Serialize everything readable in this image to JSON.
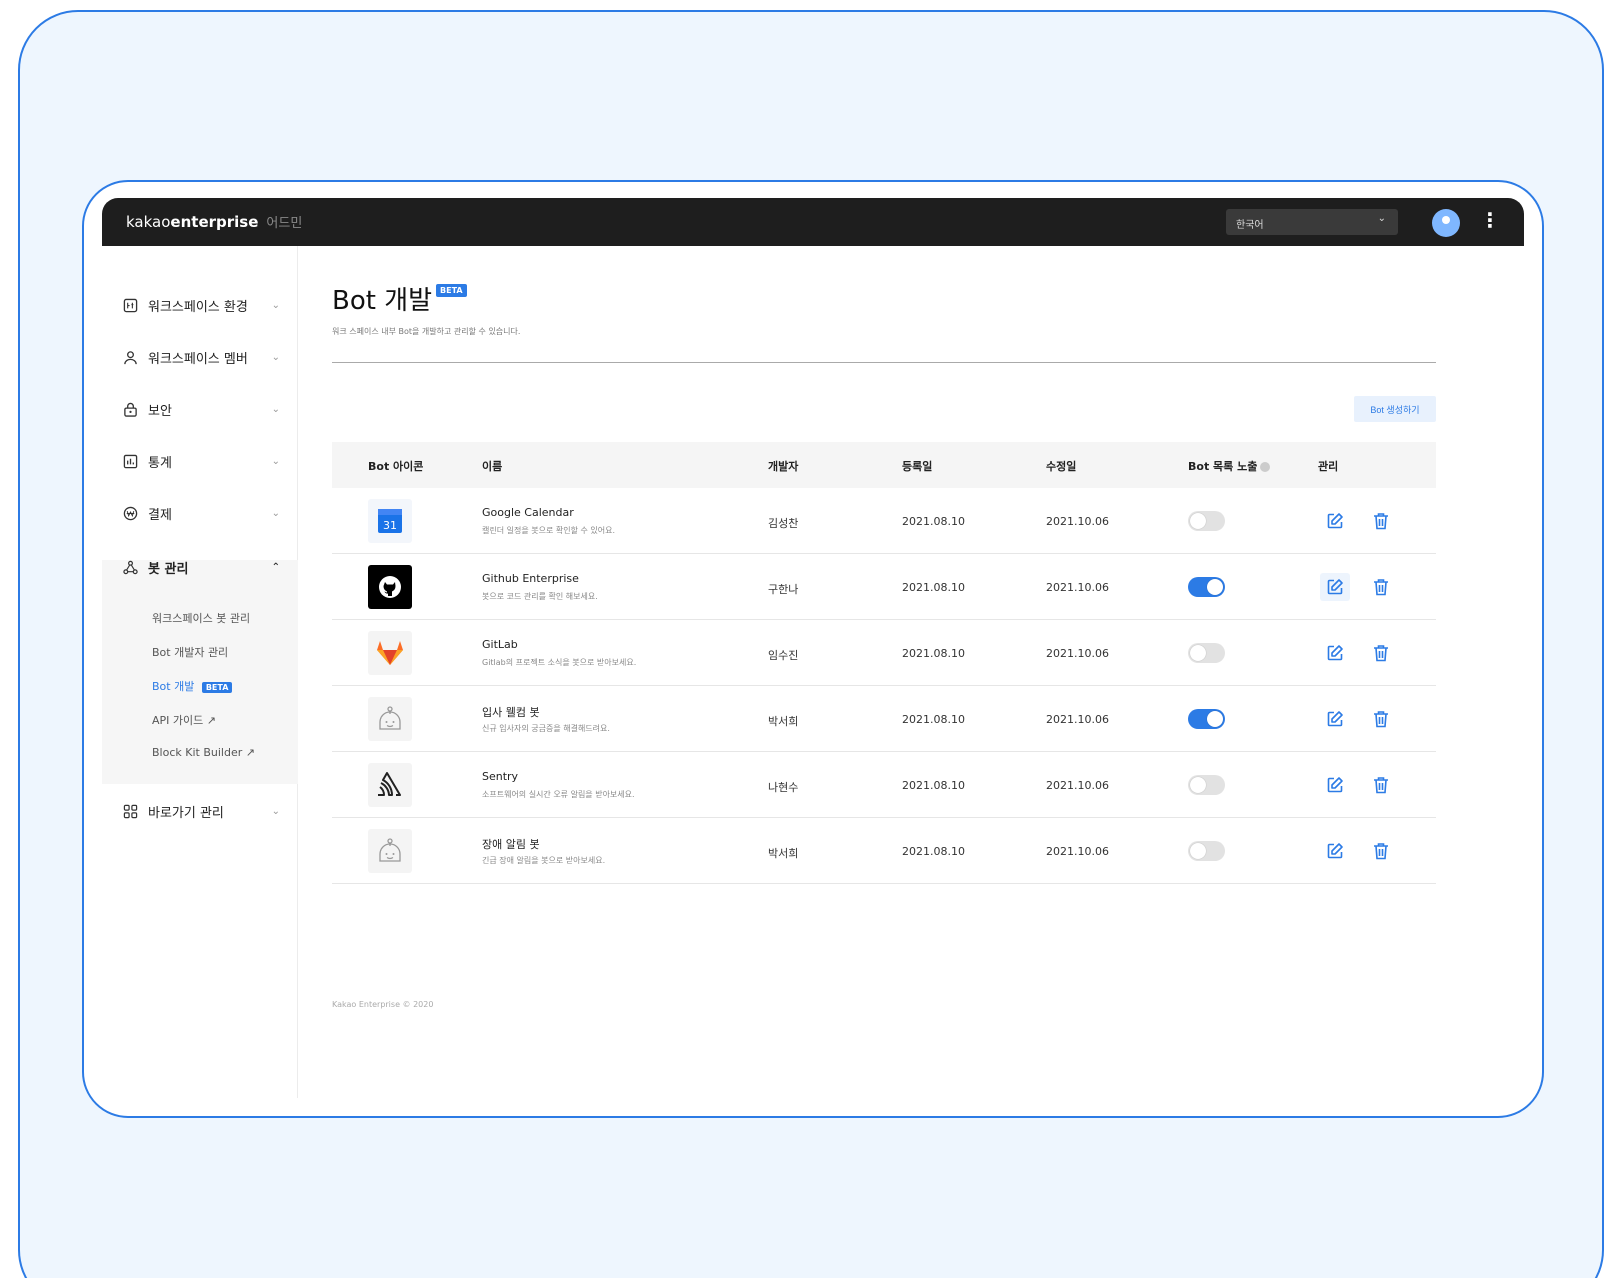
{
  "topbar": {
    "brand_part1": "kakao",
    "brand_part2": "enterprise",
    "brand_suffix": "어드민",
    "language": "한국어"
  },
  "sidebar": {
    "items": [
      {
        "label": "워크스페이스 환경",
        "icon": "workspace-settings-icon",
        "chevron": "⌄"
      },
      {
        "label": "워크스페이스 멤버",
        "icon": "person-icon",
        "chevron": "⌄"
      },
      {
        "label": "보안",
        "icon": "lock-icon",
        "chevron": "⌄"
      },
      {
        "label": "통계",
        "icon": "chart-icon",
        "chevron": "⌄"
      },
      {
        "label": "결제",
        "icon": "won-icon",
        "chevron": "⌄"
      },
      {
        "label": "봇 관리",
        "icon": "bot-network-icon",
        "chevron": "⌃"
      },
      {
        "label": "바로가기 관리",
        "icon": "grid-icon",
        "chevron": "⌄"
      }
    ],
    "sub_items": [
      {
        "label": "워크스페이스 봇 관리"
      },
      {
        "label": "Bot 개발자 관리"
      },
      {
        "label": "Bot 개발",
        "badge": "BETA"
      },
      {
        "label": "API 가이드 ↗"
      },
      {
        "label": "Block Kit Builder ↗"
      }
    ]
  },
  "main": {
    "title": "Bot 개발",
    "title_badge": "BETA",
    "description": "워크 스페이스 내부 Bot을 개발하고 관리할 수 있습니다.",
    "create_button": "Bot 생성하기",
    "columns": [
      "Bot 아이콘",
      "이름",
      "개발자",
      "등록일",
      "수정일",
      "Bot 목록 노출",
      "관리"
    ],
    "rows": [
      {
        "name": "Google Calendar",
        "desc": "캘린더 일정을 봇으로 확인할 수 있어요.",
        "developer": "김성찬",
        "registered": "2021.08.10",
        "modified": "2021.10.06",
        "exposed": false,
        "icon": "google-calendar-icon",
        "icon_text": "31"
      },
      {
        "name": "Github Enterprise",
        "desc": "봇으로 코드 관리를 확인 해보세요.",
        "developer": "구한나",
        "registered": "2021.08.10",
        "modified": "2021.10.06",
        "exposed": true,
        "icon": "github-icon"
      },
      {
        "name": "GitLab",
        "desc": "Gitlab의 프로젝트 소식을 봇으로 받아보세요.",
        "developer": "임수진",
        "registered": "2021.08.10",
        "modified": "2021.10.06",
        "exposed": false,
        "icon": "gitlab-icon"
      },
      {
        "name": "입사 웰컴 봇",
        "desc": "신규 입사자의 궁금증을 해결해드려요.",
        "developer": "박서희",
        "registered": "2021.08.10",
        "modified": "2021.10.06",
        "exposed": true,
        "icon": "robot-icon"
      },
      {
        "name": "Sentry",
        "desc": "소프트웨어의 실시간 오류 알림을 받아보세요.",
        "developer": "나현수",
        "registered": "2021.08.10",
        "modified": "2021.10.06",
        "exposed": false,
        "icon": "sentry-icon"
      },
      {
        "name": "장애 알림 봇",
        "desc": "긴급 장애 알림을 봇으로 받아보세요.",
        "developer": "박서희",
        "registered": "2021.08.10",
        "modified": "2021.10.06",
        "exposed": false,
        "icon": "robot-icon"
      }
    ],
    "footer": "Kakao Enterprise © 2020"
  },
  "colors": {
    "accent": "#2c7be5",
    "topbar": "#1e1e1e",
    "frame_bg": "#eef6fe"
  }
}
